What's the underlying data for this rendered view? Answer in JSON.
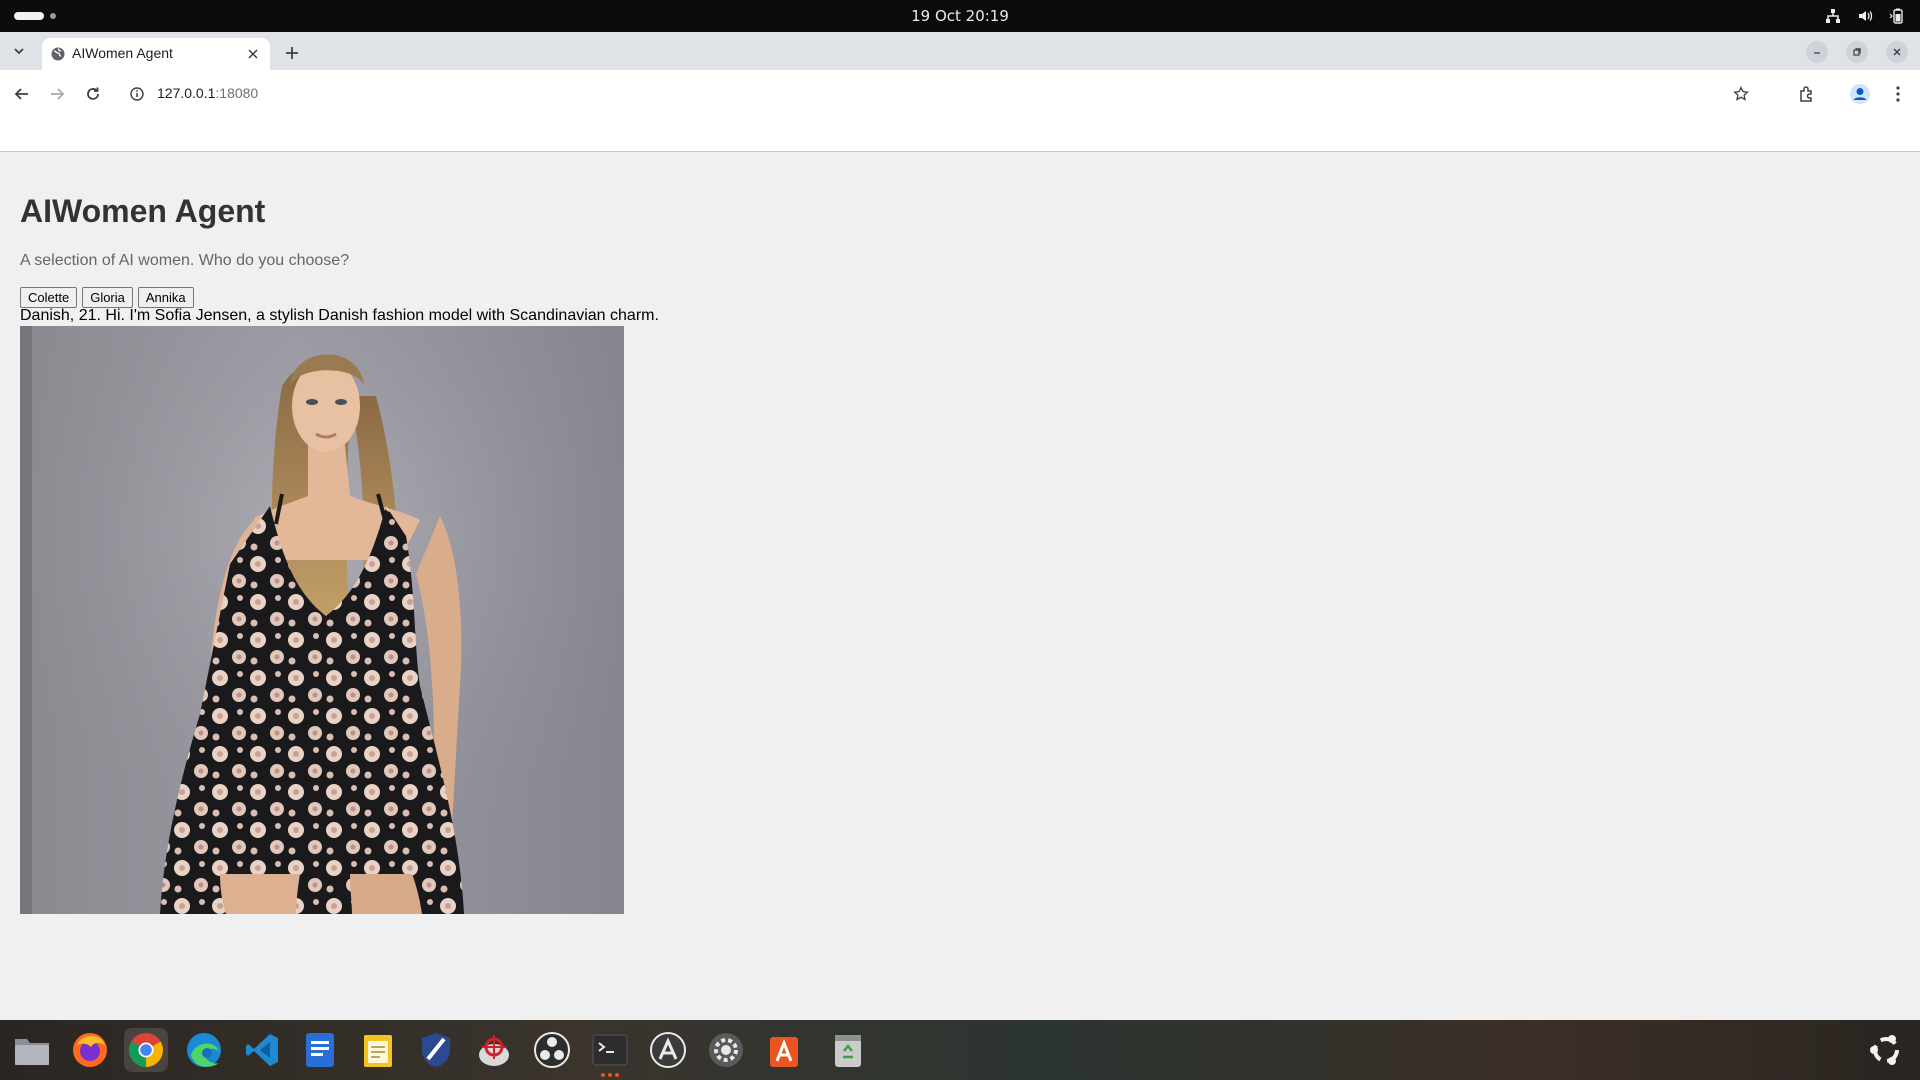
{
  "system_bar": {
    "clock": "19 Oct  20:19",
    "tray_icons": [
      "network-icon",
      "volume-icon",
      "battery-icon"
    ]
  },
  "browser": {
    "tab": {
      "title": "AIWomen Agent",
      "favicon": "globe-icon"
    },
    "url": {
      "host": "127.0.0.1",
      "port": ":18080"
    },
    "toolbar_icons": [
      "back-arrow-icon",
      "forward-arrow-icon",
      "reload-icon",
      "star-icon",
      "extensions-icon",
      "profile-icon",
      "menu-dots-icon"
    ]
  },
  "page": {
    "title": "AIWomen Agent",
    "subtitle": "A selection of AI women. Who do you choose?",
    "choices": [
      "Colette",
      "Gloria",
      "Annika"
    ],
    "bio": "Danish, 21. Hi. I'm Sofia Jensen, a stylish Danish fashion model with Scandinavian charm.",
    "portrait": {
      "subject": "woman in floral mini dress against grey backdrop"
    }
  },
  "dock": {
    "apps": [
      "files-icon",
      "firefox-icon",
      "chrome-icon",
      "edge-icon",
      "vscode-icon",
      "docs-viewer-icon",
      "text-editor-icon",
      "security-shield-icon",
      "screenshot-tool-icon",
      "obs-icon",
      "terminal-icon",
      "software-updater-icon",
      "settings-icon",
      "app-store-icon",
      "trash-icon"
    ],
    "active_app": "chrome-icon",
    "running_app": "terminal-icon",
    "show_apps": "ubuntu-logo-icon"
  },
  "colors": {
    "topbar": "#0b0b0b",
    "tabstrip": "#dfe2e7",
    "page_bg": "#f0f0f0",
    "accent_orange": "#e95420",
    "chrome_blue": "#0b57d0"
  }
}
